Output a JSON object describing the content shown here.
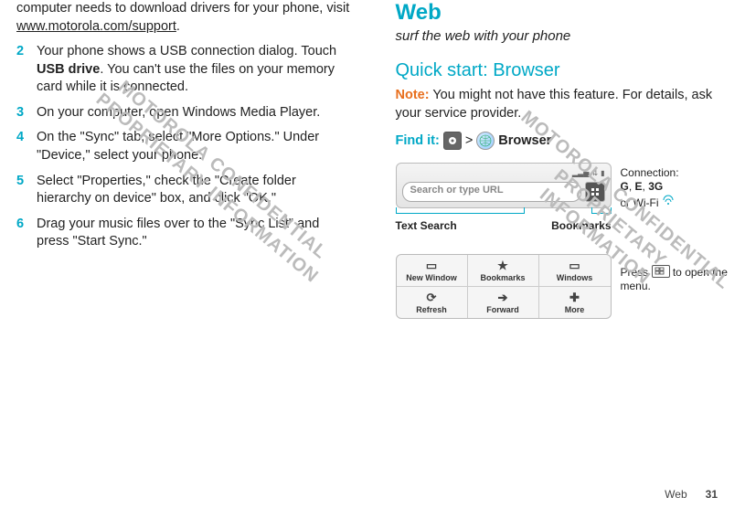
{
  "left": {
    "cont_text_a": "computer needs to download drivers for your phone, visit ",
    "cont_link": "www.motorola.com/support",
    "cont_text_b": ".",
    "step2_a": "Your phone shows a USB connection dialog. Touch ",
    "step2_bold": "USB drive",
    "step2_b": ". You can't use the files on your memory card while it is connected.",
    "step3": "On your computer, open Windows Media Player.",
    "step4": "On the \"Sync\" tab, select \"More Options.\" Under \"Device,\" select your phone.",
    "step5": "Select \"Properties,\" check the \"Create folder hierarchy on device\" box, and click \"OK.\"",
    "step6": "Drag your music files over to the \"Sync List\" and press \"Start Sync.\"",
    "nums": {
      "n2": "2",
      "n3": "3",
      "n4": "4",
      "n5": "5",
      "n6": "6"
    }
  },
  "right": {
    "h1": "Web",
    "subtitle": "surf the web with your phone",
    "h2": "Quick start: Browser",
    "note_label": "Note:",
    "note_text": " You might not have this feature. For details, ask your service provider.",
    "findit_label": "Find it:",
    "gt": ">",
    "browser_bold": "Browser",
    "url_placeholder": "Search or type URL",
    "callout_text_search": "Text Search",
    "callout_bookmarks": "Bookmarks",
    "side_conn_label": "Connection:",
    "side_conn_text_a": "G",
    "side_conn_comma1": ", ",
    "side_conn_text_b": "E",
    "side_conn_comma2": ", ",
    "side_conn_text_c": "3G",
    "side_conn_line2": "or Wi-Fi",
    "menu_items": {
      "new_window": "New Window",
      "bookmarks": "Bookmarks",
      "windows": "Windows",
      "refresh": "Refresh",
      "forward": "Forward",
      "more": "More"
    },
    "side_menu_a": "Press ",
    "side_menu_b": " to open the menu."
  },
  "footer": {
    "section": "Web",
    "page": "31"
  },
  "watermark": {
    "line1": "MOTOROLA CONFIDENTIAL",
    "line2": "PROPRIETARY INFORMATION"
  }
}
